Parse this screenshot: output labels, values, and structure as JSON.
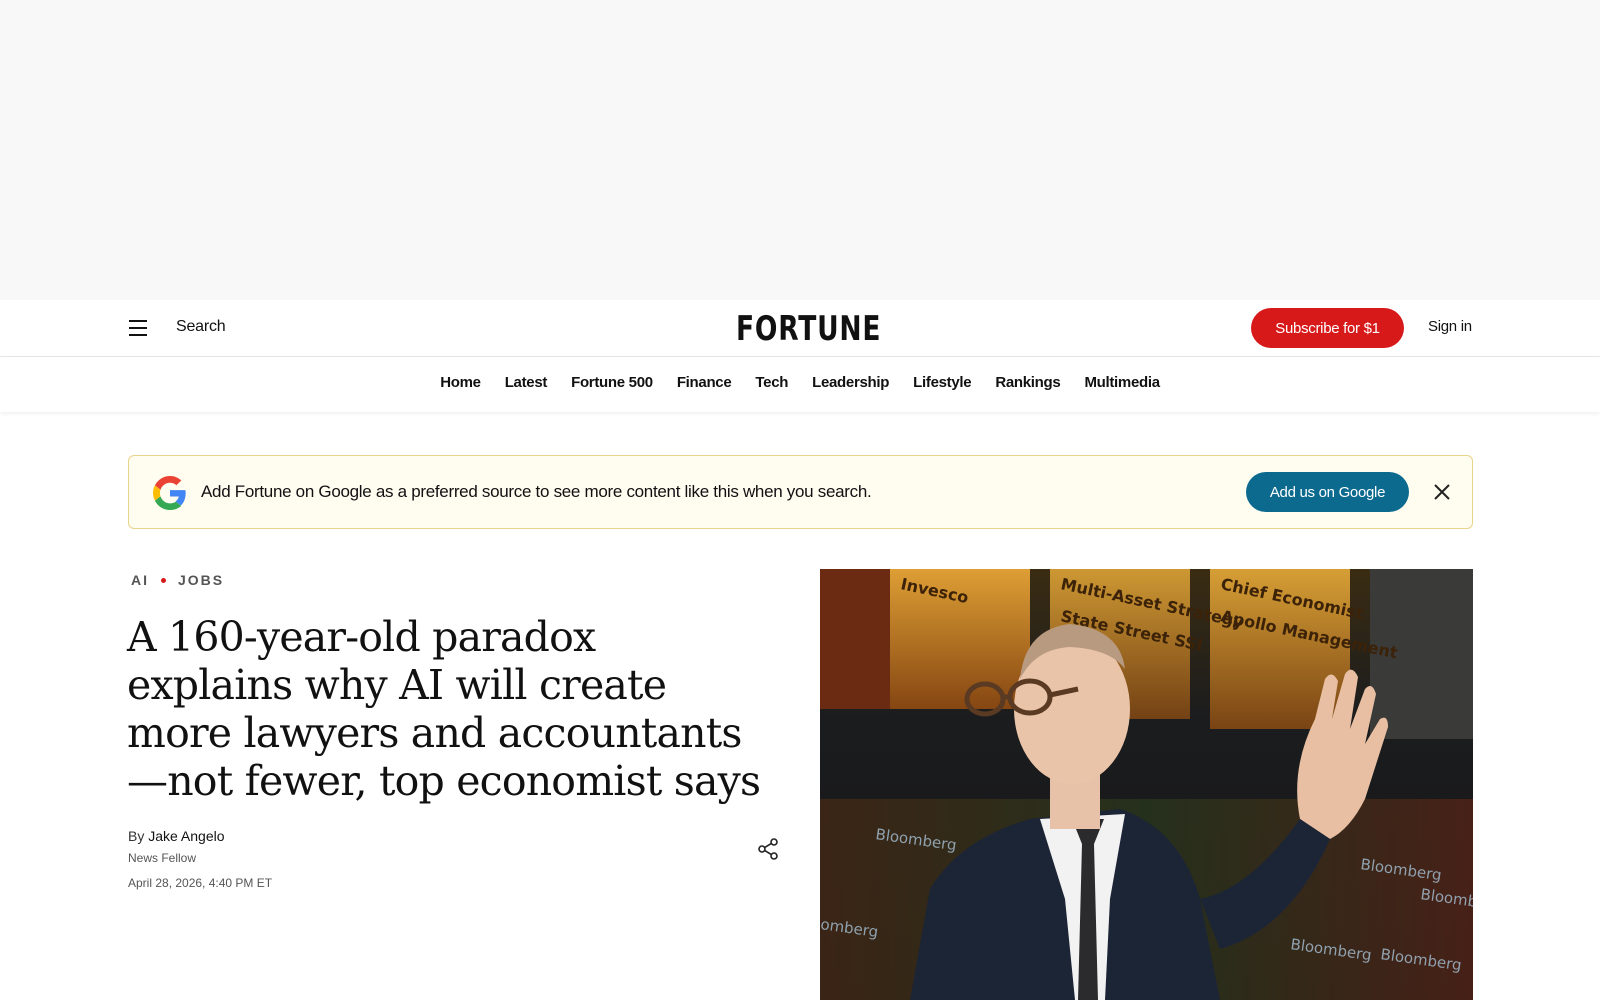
{
  "header": {
    "search_label": "Search",
    "logo_text": "FORTUNE",
    "subscribe_label": "Subscribe for $1",
    "signin_label": "Sign in",
    "brand_color": "#d7191a"
  },
  "nav": {
    "items": [
      "Home",
      "Latest",
      "Fortune 500",
      "Finance",
      "Tech",
      "Leadership",
      "Lifestyle",
      "Rankings",
      "Multimedia"
    ]
  },
  "banner": {
    "text": "Add Fortune on Google as a preferred source to see more content like this when you search.",
    "button_label": "Add us on Google",
    "button_color": "#0c6a8e"
  },
  "article": {
    "tags": [
      "AI",
      "JOBS"
    ],
    "headline": "A 160-year-old paradox explains why AI will create more lawyers and accountants—not fewer, top economist says",
    "by_prefix": "By",
    "author": "Jake Angelo",
    "author_role": "News Fellow",
    "date": "April 28, 2026, 4:40 PM ET"
  },
  "hero_image": {
    "screen_text": [
      "Invesco",
      "Multi-Asset Strategy",
      "State Street SSI",
      "Chief Economist",
      "Apollo Management",
      "Bloomberg",
      "Bloomberg",
      "Bloomberg",
      "omberg",
      "Bloomberg",
      "Bloomberg"
    ]
  }
}
